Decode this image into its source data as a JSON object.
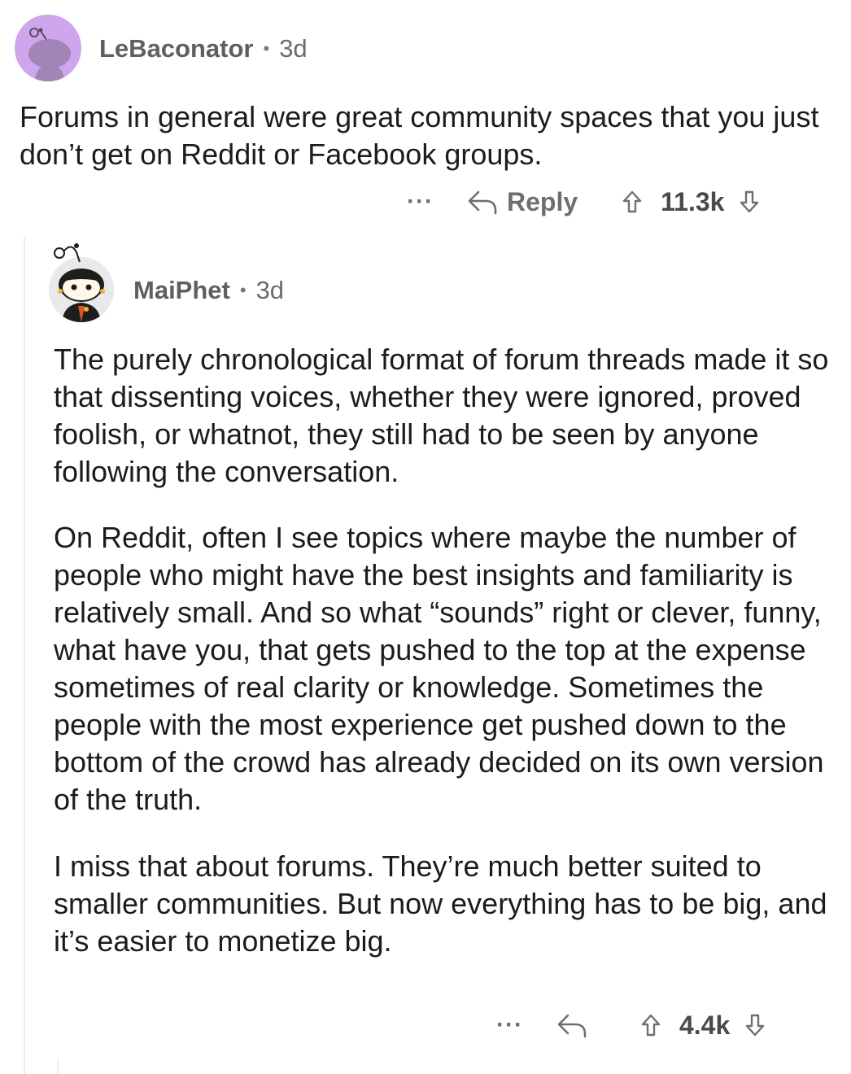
{
  "parent_comment": {
    "username": "LeBaconator",
    "age": "3d",
    "body": "Forums in general were great community spaces that you just don’t get on Reddit or Facebook groups.",
    "actions": {
      "more_label": "···",
      "reply_label": "Reply",
      "score": "11.3k"
    }
  },
  "reply_comment": {
    "username": "MaiPhet",
    "age": "3d",
    "paragraphs": [
      "The purely chronological format of forum threads made it so that dissenting voices, whether they were ignored, proved foolish, or whatnot, they still had to be seen by anyone following the conversation.",
      "On Reddit, often I see topics where maybe the number of people who might have the best insights and familiarity is relatively small. And so what “sounds” right or clever, funny, what have you, that gets pushed to the top at the expense sometimes of real clarity or knowledge. Sometimes the people with the most experience get pushed down to the bottom of the crowd has already decided on its own version of the truth.",
      "I miss that about forums. They’re much better suited to smaller communities. But now everything has to be big, and it’s easier to monetize big."
    ],
    "actions": {
      "more_label": "···",
      "score": "4.4k"
    }
  },
  "separator": "•",
  "colors": {
    "parent_avatar_bg": "#cfa6ec",
    "reply_avatar_bg": "#e9e9ec",
    "meta_text": "#6b6b6b",
    "action_text": "#6f6f6f",
    "thread_line": "#ececec"
  }
}
